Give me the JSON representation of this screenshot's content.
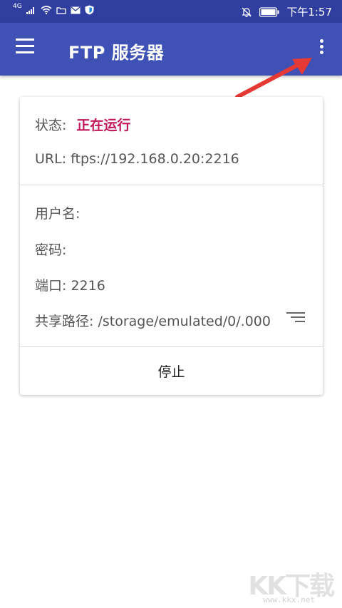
{
  "status_bar": {
    "network": "4G",
    "time": "下午1:57"
  },
  "app_bar": {
    "title": "FTP 服务器"
  },
  "server": {
    "status_label": "状态:",
    "status_value": "正在运行",
    "url": "URL: ftps://192.168.0.20:2216",
    "username_label": "用户名:",
    "password_label": "密码:",
    "port_text": "端口: 2216",
    "share_path_text": "共享路径: /storage/emulated/0/.000",
    "stop_label": "停止"
  },
  "watermark": {
    "logo": "KK下载",
    "site": "www.kkx.net"
  },
  "colors": {
    "status_bar": "#303f9f",
    "app_bar": "#3f51b5",
    "status_running": "#c2185b",
    "annotation_arrow": "#e53935"
  },
  "icons": [
    "signal-icon",
    "wifi-icon",
    "folder-icon",
    "mail-icon",
    "shield-icon",
    "mute-bell-icon",
    "battery-icon",
    "menu-icon",
    "more-vert-icon",
    "sort-icon"
  ]
}
